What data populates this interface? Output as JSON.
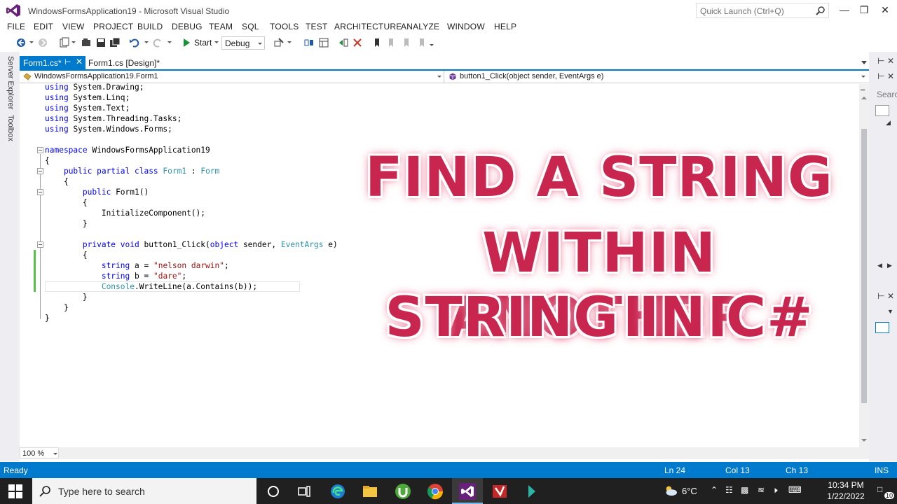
{
  "window": {
    "title": "WindowsFormsApplication19 - Microsoft Visual Studio",
    "quick_launch_placeholder": "Quick Launch (Ctrl+Q)"
  },
  "menu": [
    "FILE",
    "EDIT",
    "VIEW",
    "PROJECT",
    "BUILD",
    "DEBUG",
    "TEAM",
    "SQL",
    "TOOLS",
    "TEST",
    "ARCHITECTURE",
    "ANALYZE",
    "WINDOW",
    "HELP"
  ],
  "toolbar": {
    "start_label": "Start",
    "config_value": "Debug"
  },
  "side_tabs": {
    "server_explorer": "Server Explorer",
    "toolbox": "Toolbox"
  },
  "doc_tabs": {
    "active": "Form1.cs*",
    "inactive": "Form1.cs [Design]*"
  },
  "navbar": {
    "class_dropdown": "WindowsFormsApplication19.Form1",
    "member_dropdown": "button1_Click(object sender, EventArgs e)"
  },
  "code": {
    "using_kw": "using",
    "usings": [
      "System.Drawing;",
      "System.Linq;",
      "System.Text;",
      "System.Threading.Tasks;",
      "System.Windows.Forms;"
    ],
    "namespace_kw": "namespace",
    "namespace_name": "WindowsFormsApplication19",
    "class_mods": "public partial class",
    "class_name": "Form1",
    "base_class": "Form",
    "ctor_kw": "public",
    "ctor_name": "Form1()",
    "init_call": "InitializeComponent();",
    "method_mods": "private void",
    "method_name": "button1_Click(",
    "param_type1": "object",
    "param_name1": "sender,",
    "param_type2": "EventArgs",
    "param_name2": "e)",
    "string_kw": "string",
    "var_a": "a =",
    "val_a": "\"nelson darwin\"",
    "var_b": "b =",
    "val_b": "\"dare\"",
    "console": "Console",
    "writeline": ".WriteLine(a.Contains(b));"
  },
  "overlay": {
    "line1": "FIND A STRING",
    "line2": "WITHIN ANOTHER",
    "line3": "STRING IN C#"
  },
  "zoom": "100 %",
  "right_panel": {
    "search_hint": "Searc"
  },
  "status": {
    "state": "Ready",
    "ln": "Ln 24",
    "col": "Col 13",
    "ch": "Ch 13",
    "mode": "INS"
  },
  "taskbar": {
    "search_placeholder": "Type here to search",
    "temperature": "6°C",
    "time": "10:34 PM",
    "date": "1/22/2022",
    "notification_count": "10"
  },
  "colors": {
    "accent": "#007acc",
    "keyword": "#0000ff",
    "type": "#2b91af",
    "string": "#a31515",
    "headline": "#c8264f"
  }
}
